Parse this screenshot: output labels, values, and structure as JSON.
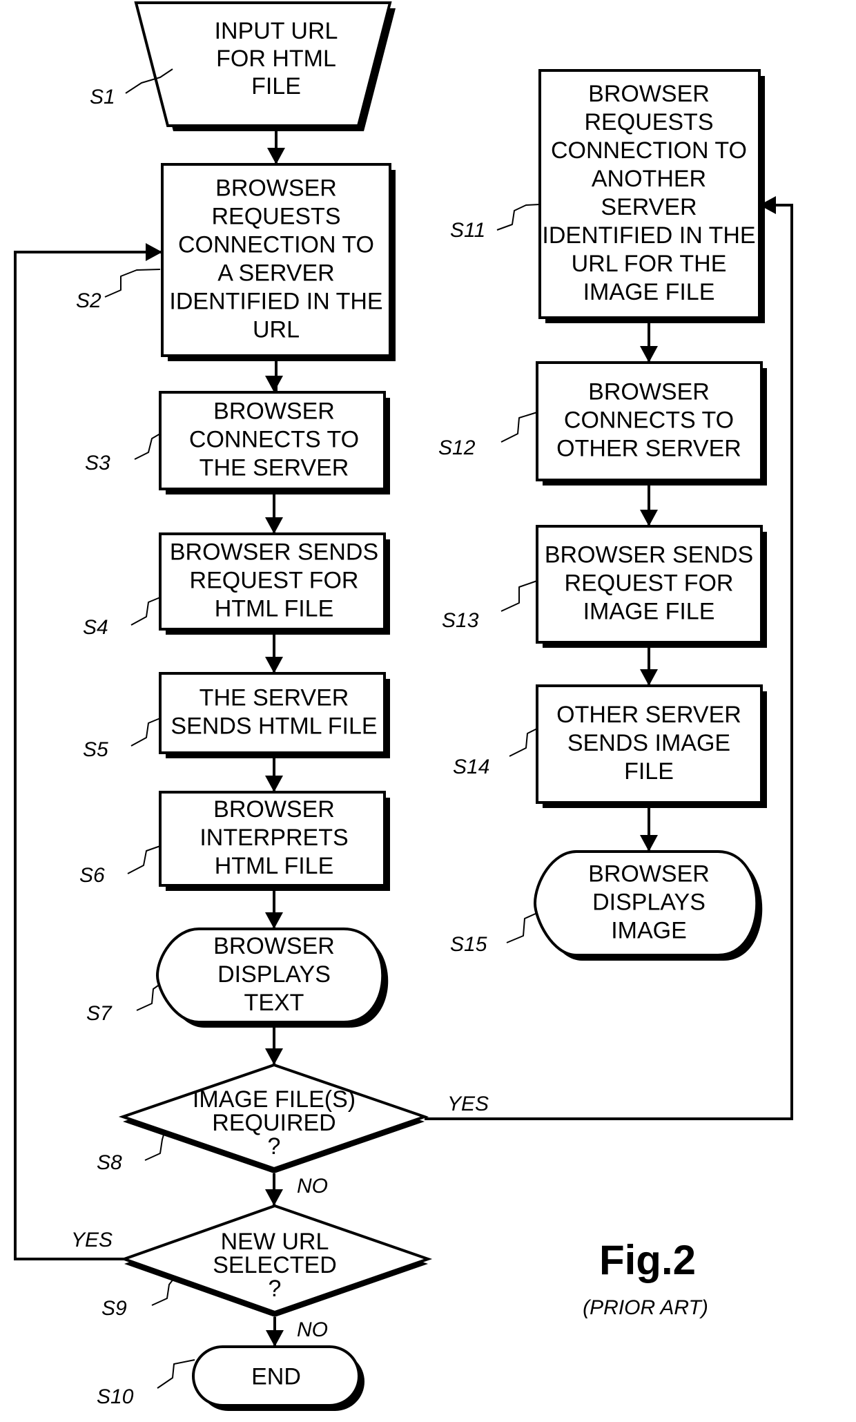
{
  "figure": {
    "title": "Fig.2",
    "subtitle": "(PRIOR ART)"
  },
  "nodes": [
    {
      "id": "S1",
      "label": "S1",
      "shape": "trapezoid",
      "lines": [
        "INPUT URL",
        "FOR HTML",
        "FILE"
      ]
    },
    {
      "id": "S2",
      "label": "S2",
      "shape": "process",
      "lines": [
        "BROWSER",
        "REQUESTS",
        "CONNECTION TO",
        "A SERVER",
        "IDENTIFIED IN THE",
        "URL"
      ]
    },
    {
      "id": "S3",
      "label": "S3",
      "shape": "process",
      "lines": [
        "BROWSER",
        "CONNECTS TO",
        "THE SERVER"
      ]
    },
    {
      "id": "S4",
      "label": "S4",
      "shape": "process",
      "lines": [
        "BROWSER SENDS",
        "REQUEST FOR",
        "HTML FILE"
      ]
    },
    {
      "id": "S5",
      "label": "S5",
      "shape": "process",
      "lines": [
        "THE SERVER",
        "SENDS HTML FILE"
      ]
    },
    {
      "id": "S6",
      "label": "S6",
      "shape": "process",
      "lines": [
        "BROWSER",
        "INTERPRETS",
        "HTML FILE"
      ]
    },
    {
      "id": "S7",
      "label": "S7",
      "shape": "display",
      "lines": [
        "BROWSER",
        "DISPLAYS",
        "TEXT"
      ]
    },
    {
      "id": "S8",
      "label": "S8",
      "shape": "decision",
      "lines": [
        "IMAGE FILE(S)",
        "REQUIRED",
        "?"
      ]
    },
    {
      "id": "S9",
      "label": "S9",
      "shape": "decision",
      "lines": [
        "NEW URL",
        "SELECTED",
        "?"
      ]
    },
    {
      "id": "S10",
      "label": "S10",
      "shape": "terminal",
      "lines": [
        "END"
      ]
    },
    {
      "id": "S11",
      "label": "S11",
      "shape": "process",
      "lines": [
        "BROWSER",
        "REQUESTS",
        "CONNECTION TO",
        "ANOTHER",
        "SERVER",
        "IDENTIFIED IN THE",
        "URL FOR THE",
        "IMAGE FILE"
      ]
    },
    {
      "id": "S12",
      "label": "S12",
      "shape": "process",
      "lines": [
        "BROWSER",
        "CONNECTS TO",
        "OTHER SERVER"
      ]
    },
    {
      "id": "S13",
      "label": "S13",
      "shape": "process",
      "lines": [
        "BROWSER SENDS",
        "REQUEST FOR",
        "IMAGE FILE"
      ]
    },
    {
      "id": "S14",
      "label": "S14",
      "shape": "process",
      "lines": [
        "OTHER SERVER",
        "SENDS IMAGE",
        "FILE"
      ]
    },
    {
      "id": "S15",
      "label": "S15",
      "shape": "display",
      "lines": [
        "BROWSER",
        "DISPLAYS",
        "IMAGE"
      ]
    }
  ],
  "edges": [
    {
      "from": "S1",
      "to": "S2",
      "label": ""
    },
    {
      "from": "S2",
      "to": "S3",
      "label": ""
    },
    {
      "from": "S3",
      "to": "S4",
      "label": ""
    },
    {
      "from": "S4",
      "to": "S5",
      "label": ""
    },
    {
      "from": "S5",
      "to": "S6",
      "label": ""
    },
    {
      "from": "S6",
      "to": "S7",
      "label": ""
    },
    {
      "from": "S7",
      "to": "S8",
      "label": ""
    },
    {
      "from": "S8",
      "to": "S9",
      "label": "NO"
    },
    {
      "from": "S8",
      "to": "S11",
      "label": "YES"
    },
    {
      "from": "S9",
      "to": "S10",
      "label": "NO"
    },
    {
      "from": "S9",
      "to": "S2",
      "label": "YES"
    },
    {
      "from": "S11",
      "to": "S12",
      "label": ""
    },
    {
      "from": "S12",
      "to": "S13",
      "label": ""
    },
    {
      "from": "S13",
      "to": "S14",
      "label": ""
    },
    {
      "from": "S14",
      "to": "S15",
      "label": ""
    }
  ]
}
